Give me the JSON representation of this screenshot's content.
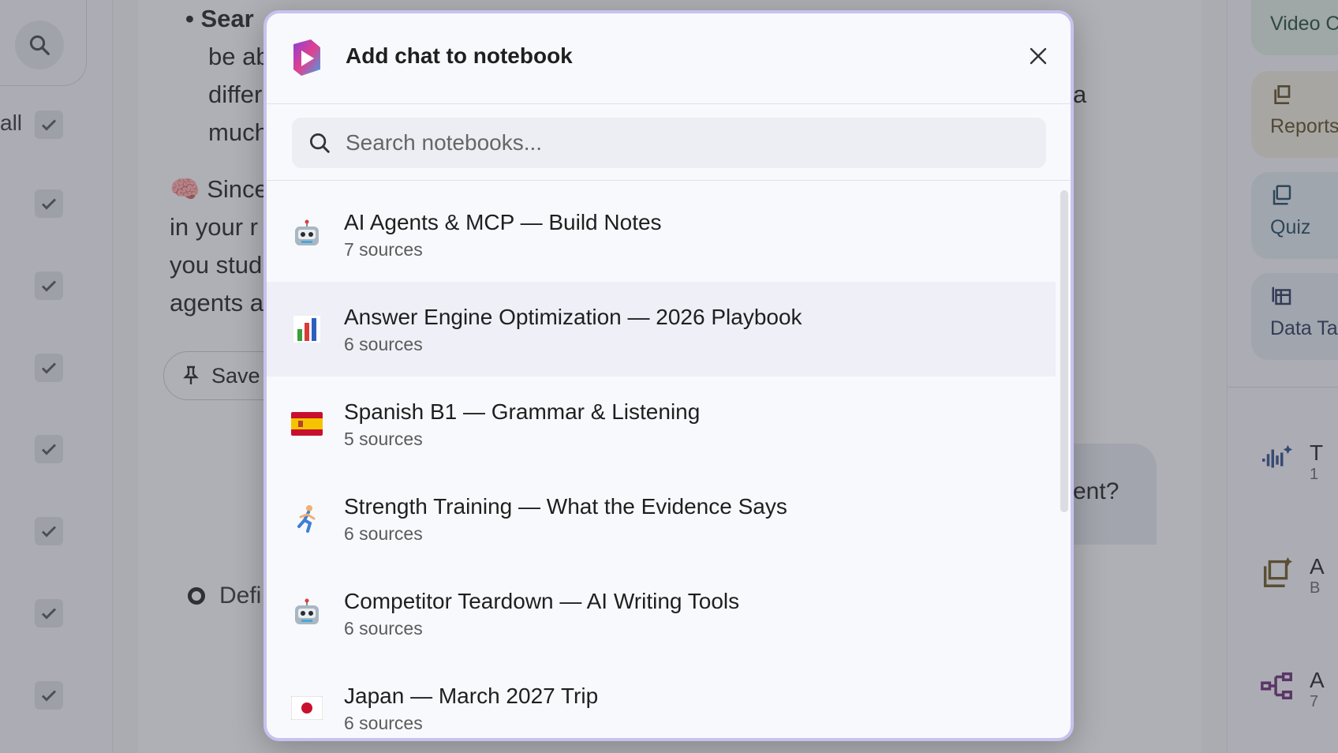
{
  "background": {
    "left_rail": {
      "all_label": "all"
    },
    "main": {
      "line1": "• Sear",
      "line2": "be ab",
      "line3": "differ",
      "line4": "much",
      "line4_tail": "a",
      "para2_l1": "🧠 Since",
      "para2_l2": "in your r",
      "para2_l3": "you stud",
      "para2_l4": "agents a",
      "save_label": "Save",
      "bubble_text": "ent?",
      "defi_text": "Defi"
    },
    "right_rail": {
      "cards": [
        {
          "label": "Video C",
          "icon": "video-icon",
          "color": "#e1ece6"
        },
        {
          "label": "Reports",
          "icon": "reports-icon",
          "color": "#efeadd"
        },
        {
          "label": "Quiz",
          "icon": "quiz-icon",
          "color": "#e2ebf2"
        },
        {
          "label": "Data Ta",
          "icon": "table-icon",
          "color": "#e4e8f2"
        }
      ],
      "items": [
        {
          "title": "T",
          "sub": "1",
          "icon": "audio-sparkle-icon"
        },
        {
          "title": "A",
          "sub": "B",
          "icon": "report-sparkle-icon"
        },
        {
          "title": "A",
          "sub": "7",
          "icon": "mindmap-icon"
        }
      ]
    }
  },
  "modal": {
    "title": "Add chat to notebook",
    "search_placeholder": "Search notebooks...",
    "notebooks": [
      {
        "emoji": "🤖",
        "title": "AI Agents & MCP — Build Notes",
        "sources": "7 sources"
      },
      {
        "emoji": "📊",
        "title": "Answer Engine Optimization — 2026 Playbook",
        "sources": "6 sources"
      },
      {
        "emoji": "🇪🇸",
        "title": "Spanish B1 — Grammar & Listening",
        "sources": "5 sources"
      },
      {
        "emoji": "🏃",
        "title": "Strength Training — What the Evidence Says",
        "sources": "6 sources"
      },
      {
        "emoji": "🤖",
        "title": "Competitor Teardown — AI Writing Tools",
        "sources": "6 sources"
      },
      {
        "emoji": "🇯🇵",
        "title": "Japan — March 2027 Trip",
        "sources": "6 sources"
      }
    ],
    "highlighted_index": 1
  }
}
